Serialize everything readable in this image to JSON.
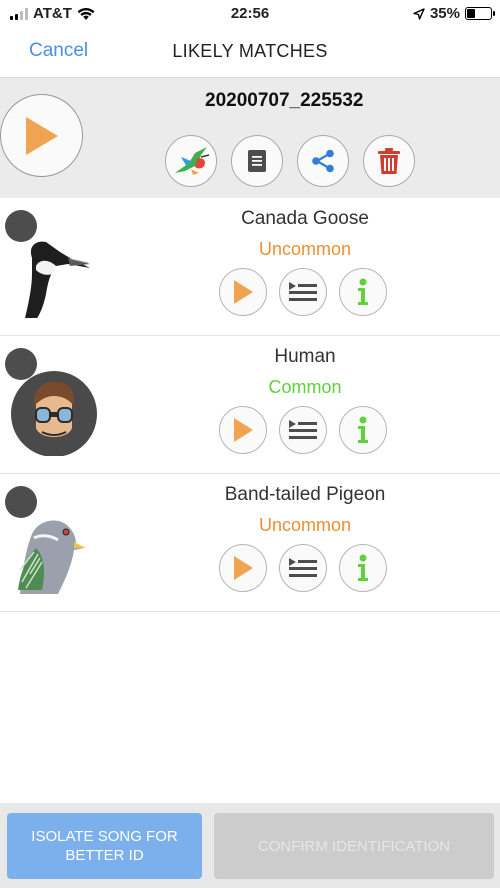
{
  "status_bar": {
    "carrier": "AT&T",
    "time": "22:56",
    "battery_text": "35%",
    "battery_level": 0.35
  },
  "nav": {
    "cancel_label": "Cancel",
    "title": "LIKELY MATCHES"
  },
  "recording": {
    "title": "20200707_225532"
  },
  "matches": [
    {
      "name": "Canada Goose",
      "frequency": "Uncommon",
      "frequency_color": "#ec8f32"
    },
    {
      "name": "Human",
      "frequency": "Common",
      "frequency_color": "#5fd13b"
    },
    {
      "name": "Band-tailed Pigeon",
      "frequency": "Uncommon",
      "frequency_color": "#ec8f32"
    }
  ],
  "bottom": {
    "isolate_label": "ISOLATE SONG  FOR\nBETTER ID",
    "confirm_label": "CONFIRM IDENTIFICATION"
  },
  "colors": {
    "accent_blue": "#4a90e2",
    "play_orange": "#f0a452",
    "delete_red": "#d33b2c",
    "share_blue": "#2f7fd6",
    "info_green": "#5fd13b"
  }
}
